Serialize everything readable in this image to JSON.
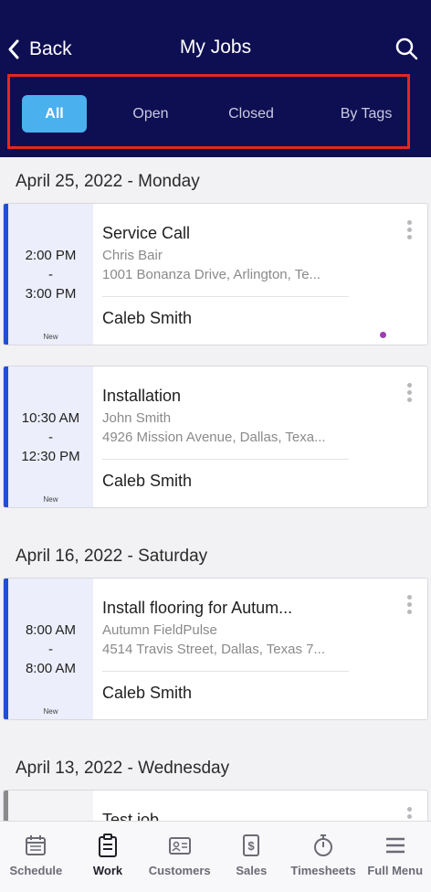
{
  "header": {
    "back_label": "Back",
    "title": "My Jobs",
    "filters": [
      "All",
      "Open",
      "Closed",
      "By Tags"
    ],
    "active_filter": "All"
  },
  "groups": [
    {
      "date": "April 25, 2022 - Monday"
    },
    {
      "date": "April 16, 2022 - Saturday"
    },
    {
      "date": "April 13, 2022 - Wednesday"
    }
  ],
  "jobs": [
    {
      "start": "2:00 PM",
      "sep": "-",
      "end": "3:00 PM",
      "status": "New",
      "title": "Service Call",
      "customer": "Chris Bair",
      "address": "1001 Bonanza Drive, Arlington, Te...",
      "tech": "Caleb Smith",
      "color": "#1f4ed8"
    },
    {
      "start": "10:30 AM",
      "sep": "-",
      "end": "12:30 PM",
      "status": "New",
      "title": "Installation",
      "customer": "John Smith",
      "address": "4926 Mission Avenue, Dallas, Texa...",
      "tech": "Caleb Smith",
      "color": "#1f4ed8"
    },
    {
      "start": "8:00 AM",
      "sep": "-",
      "end": "8:00 AM",
      "status": "New",
      "title": "Install flooring for Autum...",
      "customer": "Autumn FieldPulse",
      "address": "4514 Travis Street, Dallas, Texas 7...",
      "tech": "Caleb Smith",
      "color": "#1f4ed8"
    },
    {
      "title": "Test job",
      "color": "#8a8a8a"
    }
  ],
  "bottom_nav": [
    {
      "label": "Schedule",
      "icon": "calendar-icon"
    },
    {
      "label": "Work",
      "icon": "clipboard-icon"
    },
    {
      "label": "Customers",
      "icon": "contact-card-icon"
    },
    {
      "label": "Sales",
      "icon": "dollar-doc-icon"
    },
    {
      "label": "Timesheets",
      "icon": "stopwatch-icon"
    },
    {
      "label": "Full Menu",
      "icon": "hamburger-icon"
    }
  ],
  "active_nav": "Work",
  "colors": {
    "header_bg": "#0e0e52",
    "accent": "#4bb0ee",
    "highlight_border": "#e4281c",
    "unread_dot": "#9b3fb0"
  }
}
